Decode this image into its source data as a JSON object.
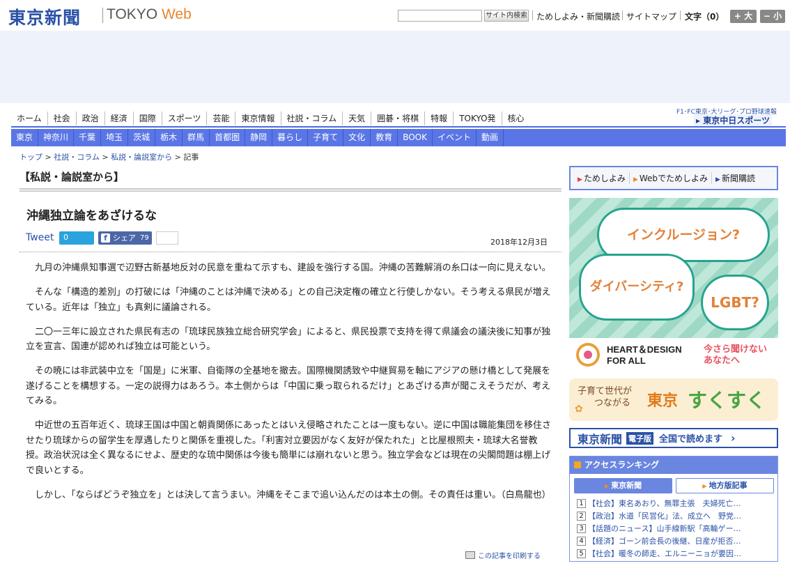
{
  "header": {
    "logo_jp": "東京新聞",
    "logo_en_main": "TOKYO ",
    "logo_en_accent": "Web",
    "search_placeholder": "",
    "search_button": "サイト内検索",
    "links": [
      "ためしよみ・新聞購読",
      "サイトマップ"
    ],
    "fontsize_label": "文字（0）",
    "fontsize_plus": "+ 大",
    "fontsize_minus": "− 小"
  },
  "nav_main": [
    "ホーム",
    "社会",
    "政治",
    "経済",
    "国際",
    "スポーツ",
    "芸能",
    "東京情報",
    "社説・コラム",
    "天気",
    "囲碁・将棋",
    "特報",
    "TOKYO発",
    "核心"
  ],
  "sports_link": {
    "top": "F1･FC東京･大リーグ･プロ野球速報",
    "bottom": "▸ 東京中日スポーツ"
  },
  "nav_region": [
    "東京",
    "神奈川",
    "千葉",
    "埼玉",
    "茨城",
    "栃木",
    "群馬",
    "首都圏",
    "静岡",
    "暮らし",
    "子育て",
    "文化",
    "教育",
    "BOOK",
    "イベント",
    "動画"
  ],
  "breadcrumb": {
    "items": [
      "トップ",
      "社説・コラム",
      "私説・論説室から"
    ],
    "current": "記事",
    "sep": " > "
  },
  "article": {
    "section_title": "【私説・論説室から】",
    "title": "沖縄独立論をあざけるな",
    "tweet": "Tweet",
    "tweet_count": "0",
    "fb_share": "シェア",
    "fb_count": "79",
    "date": "2018年12月3日",
    "paragraphs": [
      "九月の沖縄県知事選で辺野古新基地反対の民意を重ねて示すも、建設を強行する国。沖縄の苦難解消の糸口は一向に見えない。",
      "そんな「構造的差別」の打破には「沖縄のことは沖縄で決める」との自己決定権の確立と行使しかない。そう考える県民が増えている。近年は「独立」も真剣に議論される。",
      "二〇一三年に設立された県民有志の「琉球民族独立総合研究学会」によると、県民投票で支持を得て県議会の議決後に知事が独立を宣言、国連が認めれば独立は可能という。",
      "その暁には非武装中立を「国是」に米軍、自衛隊の全基地を撤去。国際機関誘致や中継貿易を軸にアジアの懸け橋として発展を遂げることを構想する。一定の説得力はあろう。本土側からは「中国に乗っ取られるだけ」とあざける声が聞こえそうだが、考えてみる。",
      "中近世の五百年近く、琉球王国は中国と朝貢関係にあったとはいえ侵略されたことは一度もない。逆に中国は職能集団を移住させたり琉球からの留学生を厚遇したりと関係を重視した。「利害対立要因がなく友好が保たれた」と比屋根照夫・琉球大名誉教授。政治状況は全く異なるにせよ、歴史的な琉中関係は今後も簡単には崩れないと思う。独立学会などは現在の尖閣問題は棚上げで良いとする。",
      "しかし、「ならばどうぞ独立を」とは決して言うまい。沖縄をそこまで追い込んだのは本土の側。その責任は重い。（白鳥龍也）"
    ],
    "print_link": "この記事を印刷する"
  },
  "sidebar": {
    "sub_links": [
      "ためしよみ",
      "Webでためしよみ",
      "新聞購読"
    ],
    "banner_hd": {
      "bubble1": "インクルージョン?",
      "bubble2": "ダイバーシティ?",
      "bubble3": "LGBT?",
      "logo_line1": "HEART＆DESIGN",
      "logo_line2": "FOR ALL",
      "question_line1": "今さら聞けない",
      "question_line2": "あなたへ"
    },
    "banner_sukusuku": {
      "line1": "子育て世代が",
      "line2": "つながる",
      "tokyo": "東京",
      "suku": "すくすく"
    },
    "banner_digital": {
      "logo": "東京新聞",
      "badge": "電子版",
      "text": "全国で読めます",
      "arrow": "›"
    },
    "ranking": {
      "title": "アクセスランキング",
      "tab_tokyo": "東京新聞",
      "tab_local": "地方版記事",
      "items": [
        {
          "num": "1",
          "text": "【社会】東名あおり、無罪主張　夫婦死亡…"
        },
        {
          "num": "2",
          "text": "【政治】水道「民営化」法、成立へ　野党…"
        },
        {
          "num": "3",
          "text": "【話題のニュース】山手線新駅「高輪ゲー…"
        },
        {
          "num": "4",
          "text": "【経済】ゴーン前会長の後継、日産が拒否…"
        },
        {
          "num": "5",
          "text": "【社会】暖冬の師走、エルニーニョが要因…"
        }
      ]
    }
  },
  "colors": {
    "brand_blue": "#2b52a8",
    "nav_blue": "#5a76e6",
    "accent_orange": "#e8862a"
  }
}
